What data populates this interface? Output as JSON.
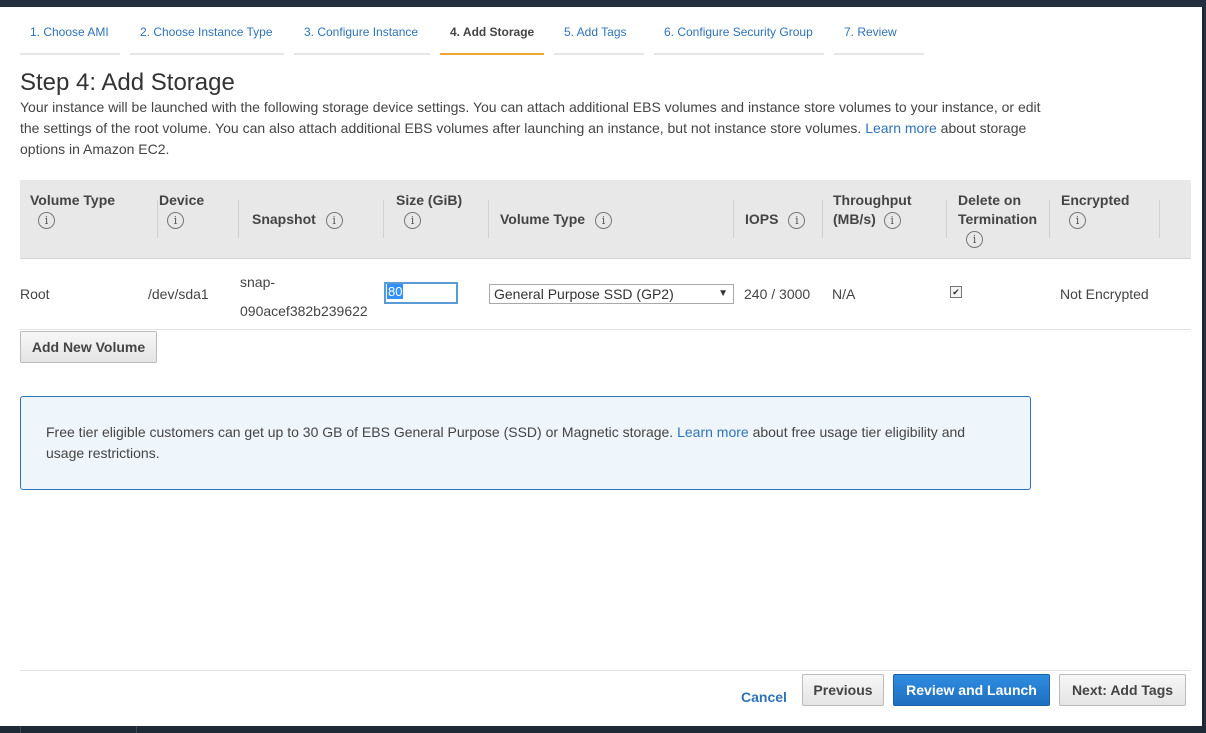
{
  "tabs": [
    {
      "label": "1. Choose AMI"
    },
    {
      "label": "2. Choose Instance Type"
    },
    {
      "label": "3. Configure Instance"
    },
    {
      "label": "4. Add Storage"
    },
    {
      "label": "5. Add Tags"
    },
    {
      "label": "6. Configure Security Group"
    },
    {
      "label": "7. Review"
    }
  ],
  "page": {
    "title": "Step 4: Add Storage",
    "desc_part1": "Your instance will be launched with the following storage device settings. You can attach additional EBS volumes and instance store volumes to your instance, or edit the settings of the root volume. You can also attach additional EBS volumes after launching an instance, but not instance store volumes.",
    "desc_link": "Learn more",
    "desc_part2": "about storage options in Amazon EC2."
  },
  "table": {
    "headers": {
      "volume_type": "Volume Type",
      "device": "Device",
      "snapshot": "Snapshot",
      "size": "Size (GiB)",
      "volume_type2": "Volume Type",
      "iops": "IOPS",
      "throughput_1": "Throughput",
      "throughput_2": "(MB/s)",
      "delete_1": "Delete on",
      "delete_2": "Termination",
      "encrypted": "Encrypted"
    },
    "row": {
      "volume_type": "Root",
      "device": "/dev/sda1",
      "snapshot_1": "snap-",
      "snapshot_2": "090acef382b239622",
      "size": "80",
      "volume_type_select": "General Purpose SSD (GP2)",
      "iops": "240 / 3000",
      "throughput": "N/A",
      "delete_on_termination": true,
      "encrypted": "Not Encrypted"
    }
  },
  "add_volume_label": "Add New Volume",
  "notice": {
    "text1": "Free tier eligible customers can get up to 30 GB of EBS General Purpose (SSD) or Magnetic storage.",
    "link": "Learn more",
    "text2": "about free usage tier eligibility and usage restrictions."
  },
  "footer": {
    "cancel": "Cancel",
    "previous": "Previous",
    "review_launch": "Review and Launch",
    "next": "Next: Add Tags"
  },
  "icons": {
    "info": "info-icon",
    "dropdown": "chevron-down-icon",
    "check": "checkmark-icon"
  },
  "colors": {
    "link": "#2e73b8",
    "active_tab_underline": "#f0a830",
    "primary_button": "#1f6fc0",
    "notice_border": "#2e73b8",
    "notice_bg": "#eef5fb"
  }
}
